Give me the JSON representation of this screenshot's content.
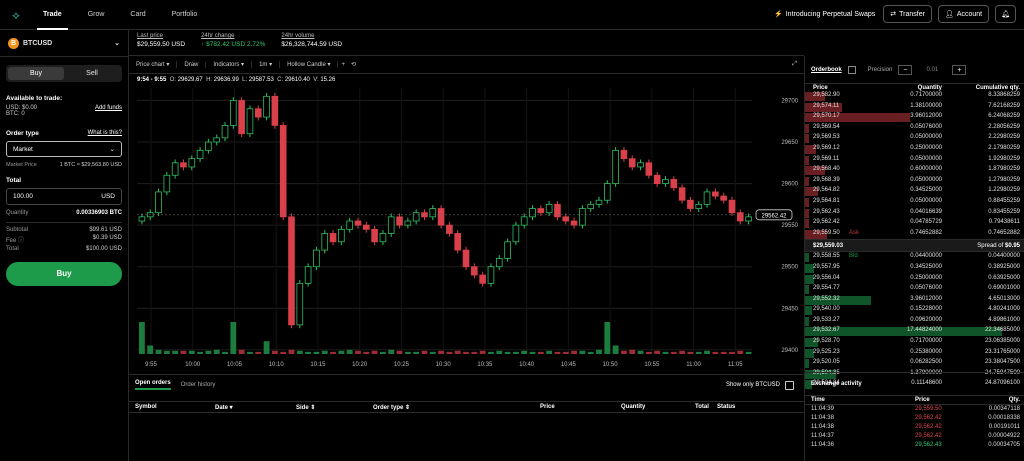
{
  "nav": {
    "tabs": [
      "Trade",
      "Grow",
      "Card",
      "Portfolio"
    ],
    "promo": "Introducing Perpetual Swaps",
    "transfer": "Transfer",
    "account": "Account"
  },
  "pair": {
    "symbol": "BTCUSD",
    "coin_letter": "B"
  },
  "trade_form": {
    "buy": "Buy",
    "sell": "Sell",
    "available_label": "Available to trade:",
    "usd_line": "USD: $0.00",
    "btc_line": "BTC: 0",
    "add_funds": "Add funds",
    "order_type_label": "Order type",
    "what_is_this": "What is this?",
    "order_type_value": "Market",
    "market_price_label": "Market Price",
    "market_price_value": "1 BTC ≈ $29,563.80 USD",
    "total_label": "Total",
    "total_value": "100.00",
    "total_currency": "USD",
    "quantity_label": "Quantity",
    "quantity_value": "0.00336903 BTC",
    "subtotal_label": "Subtotal",
    "subtotal_value": "$99.61 USD",
    "fee_label": "Fee",
    "fee_value": "$0.39 USD",
    "grand_total_label": "Total",
    "grand_total_value": "$100.00 USD",
    "submit": "Buy"
  },
  "stats": [
    {
      "label": "Last price",
      "value": "$29,559.50 USD"
    },
    {
      "label": "24hr change",
      "value": "↑ $782.42 USD 2.72%"
    },
    {
      "label": "24hr volume",
      "value": "$26,328,744.59 USD"
    }
  ],
  "toolbar": {
    "items": [
      "Price chart ▾",
      "Draw",
      "Indicators ▾",
      "1m ▾",
      "Hollow Candle ▾",
      "+",
      "⟲"
    ]
  },
  "ohlc": {
    "range": "9:54 - 9:55",
    "o": "29629.67",
    "h": "29636.99",
    "l": "29587.53",
    "c": "29610.40",
    "v": "15.26"
  },
  "chart_data": {
    "type": "candlestick",
    "x_ticks": [
      "9:55",
      "10:00",
      "10:05",
      "10:10",
      "10:15",
      "10:20",
      "10:25",
      "10:30",
      "10:35",
      "10:40",
      "10:45",
      "10:50",
      "10:55",
      "11:00",
      "11:05"
    ],
    "y_ticks": [
      29700,
      29650,
      29600,
      29550,
      29500,
      29450,
      29400
    ],
    "ylim": [
      29395,
      29715
    ],
    "last_price_label": "29562.42",
    "closes": [
      29560,
      29565,
      29590,
      29610,
      29625,
      29620,
      29630,
      29640,
      29650,
      29655,
      29670,
      29700,
      29660,
      29690,
      29680,
      29705,
      29670,
      29560,
      29430,
      29480,
      29500,
      29520,
      29540,
      29530,
      29545,
      29555,
      29550,
      29545,
      29530,
      29540,
      29560,
      29550,
      29555,
      29565,
      29560,
      29570,
      29550,
      29540,
      29520,
      29500,
      29490,
      29480,
      29500,
      29510,
      29530,
      29550,
      29560,
      29570,
      29565,
      29575,
      29560,
      29555,
      29550,
      29570,
      29575,
      29580,
      29600,
      29640,
      29630,
      29620,
      29625,
      29610,
      29600,
      29605,
      29595,
      29580,
      29570,
      29575,
      29590,
      29585,
      29580,
      29565,
      29555,
      29560
    ],
    "volumes": [
      30,
      8,
      4,
      3,
      3,
      3,
      3,
      2,
      3,
      4,
      2,
      30,
      4,
      2,
      2,
      12,
      3,
      2,
      4,
      3,
      2,
      2,
      3,
      2,
      3,
      4,
      3,
      2,
      3,
      2,
      4,
      3,
      2,
      2,
      3,
      2,
      3,
      2,
      3,
      2,
      2,
      3,
      2,
      3,
      2,
      2,
      3,
      2,
      2,
      3,
      2,
      2,
      3,
      3,
      2,
      4,
      30,
      8,
      3,
      4,
      3,
      2,
      3,
      2,
      2,
      3,
      2,
      2,
      3,
      2,
      2,
      2,
      3,
      2
    ]
  },
  "orderbook": {
    "title": "Orderbook",
    "precision_label": "Precision",
    "precision_value": "0.01",
    "columns": [
      "Price",
      "Quantity",
      "Cumulative qty."
    ],
    "asks": [
      [
        "29,582.90",
        "0.71700000",
        "8.33868259"
      ],
      [
        "29,574.11",
        "1.38100000",
        "7.62168259"
      ],
      [
        "29,570.17",
        "3.96012000",
        "6.24068259"
      ],
      [
        "29,569.54",
        "0.05076000",
        "2.28056259"
      ],
      [
        "29,569.53",
        "0.05000000",
        "2.22980259"
      ],
      [
        "29,569.12",
        "0.25000000",
        "2.17980259"
      ],
      [
        "29,569.11",
        "0.05000000",
        "1.92980259"
      ],
      [
        "29,568.40",
        "0.60000000",
        "1.87980259"
      ],
      [
        "29,568.39",
        "0.05000000",
        "1.27980259"
      ],
      [
        "29,564.82",
        "0.34525000",
        "1.22980259"
      ],
      [
        "29,564.81",
        "0.05000000",
        "0.88455259"
      ],
      [
        "29,562.43",
        "0.04016639",
        "0.83455259"
      ],
      [
        "29,562.42",
        "0.04785729",
        "0.79438611"
      ],
      [
        "29,559.50",
        "0.74652882",
        "0.74652882"
      ]
    ],
    "ask_tag": "Ask",
    "bid_tag": "Bid",
    "mid_price": "$29,559.03",
    "spread_label": "Spread of",
    "spread_value": "$0.95",
    "bids": [
      [
        "29,558.55",
        "0.04400000",
        "0.04400000"
      ],
      [
        "29,557.95",
        "0.34525000",
        "0.38925000"
      ],
      [
        "29,556.04",
        "0.25000000",
        "0.63925000"
      ],
      [
        "29,554.77",
        "0.05076000",
        "0.69001000"
      ],
      [
        "29,552.32",
        "3.96012000",
        "4.65013000"
      ],
      [
        "29,540.00",
        "0.15228000",
        "4.80241000"
      ],
      [
        "29,533.27",
        "0.09620000",
        "4.89861000"
      ],
      [
        "29,532.67",
        "17.44824000",
        "22.34685000"
      ],
      [
        "29,528.70",
        "0.71700000",
        "23.06385000"
      ],
      [
        "29,525.23",
        "0.25380000",
        "23.31765000"
      ],
      [
        "29,520.05",
        "0.06282500",
        "23.38047500"
      ],
      [
        "29,504.35",
        "1.37900000",
        "24.75947500"
      ],
      [
        "29,504.34",
        "0.11148600",
        "24.87096100"
      ]
    ],
    "ask_qty_pct": [
      0.09,
      0.17,
      0.48,
      0.02,
      0.02,
      0.05,
      0.02,
      0.09,
      0.02,
      0.06,
      0.02,
      0.02,
      0.02,
      0.1
    ],
    "bid_qty_pct": [
      0.02,
      0.04,
      0.04,
      0.02,
      0.3,
      0.03,
      0.02,
      0.9,
      0.06,
      0.04,
      0.02,
      0.14,
      0.03
    ]
  },
  "orders": {
    "tabs": [
      "Open orders",
      "Order history"
    ],
    "toggle_label": "Show only BTCUSD",
    "columns": [
      "Symbol",
      "Date ▾",
      "Side ⇕",
      "Order type ⇕",
      "Price",
      "Quantity",
      "Total",
      "Status"
    ]
  },
  "activity": {
    "title": "Exchange activity",
    "columns": [
      "Time",
      "Price",
      "Qty."
    ],
    "rows": [
      {
        "time": "11:04:39",
        "price": "29,559.50",
        "qty": "0.00347118",
        "side": "sell"
      },
      {
        "time": "11:04:38",
        "price": "29,562.42",
        "qty": "0.00018338",
        "side": "sell"
      },
      {
        "time": "11:04:38",
        "price": "29,562.42",
        "qty": "0.00191011",
        "side": "sell"
      },
      {
        "time": "11:04:37",
        "price": "29,562.42",
        "qty": "0.00004922",
        "side": "sell"
      },
      {
        "time": "11:04:36",
        "price": "29,562.43",
        "qty": "0.00034705",
        "side": "buy"
      }
    ]
  },
  "colors": {
    "green": "#1d9a4a",
    "red": "#c0363d",
    "bg": "#000000"
  }
}
